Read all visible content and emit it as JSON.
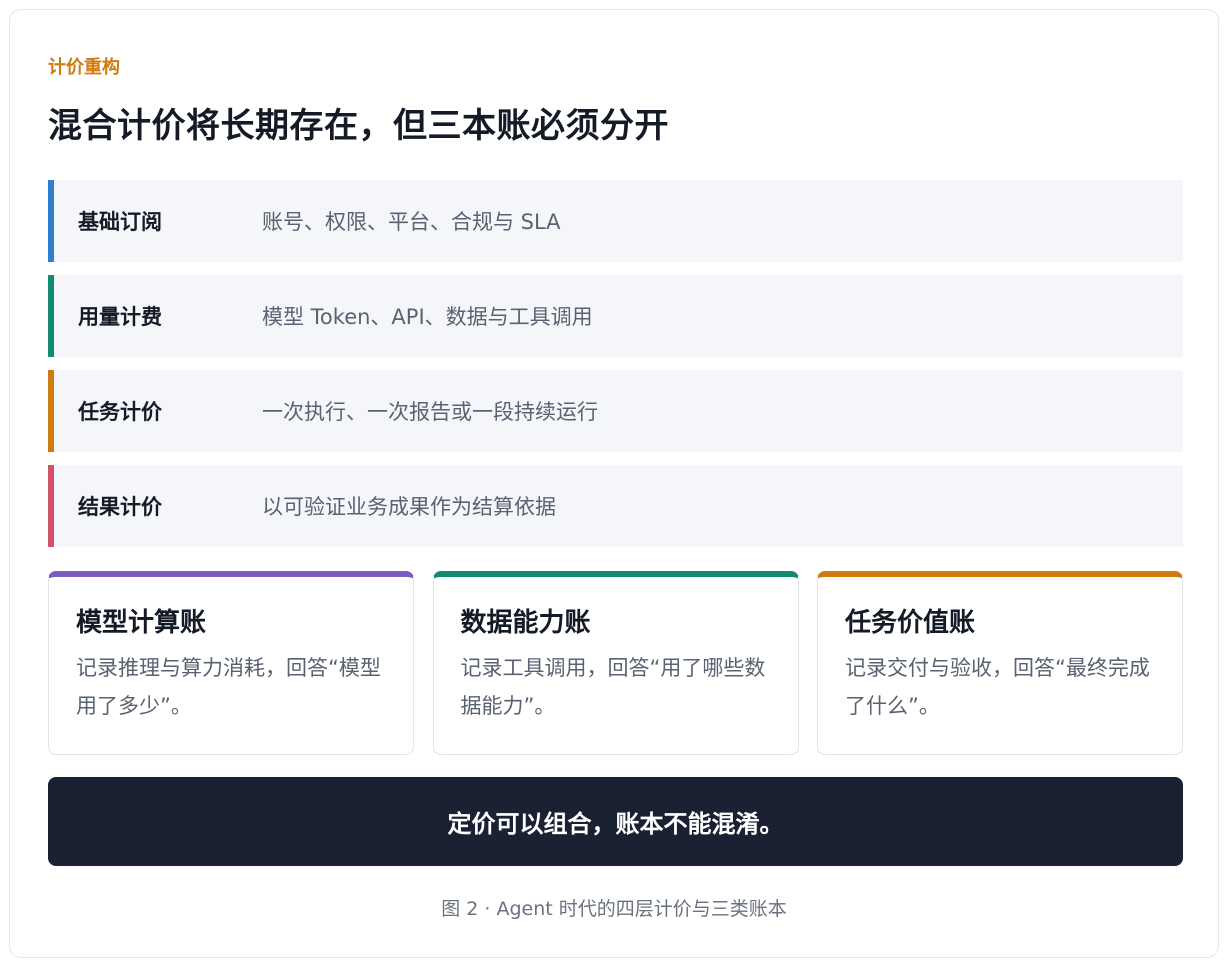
{
  "eyebrow": "计价重构",
  "headline": "混合计价将长期存在，但三本账必须分开",
  "tiers": [
    {
      "name": "基础订阅",
      "desc": "账号、权限、平台、合规与 SLA",
      "color": "#2f7fcf"
    },
    {
      "name": "用量计费",
      "desc": "模型 Token、API、数据与工具调用",
      "color": "#138a72"
    },
    {
      "name": "任务计价",
      "desc": "一次执行、一次报告或一段持续运行",
      "color": "#d07a10"
    },
    {
      "name": "结果计价",
      "desc": "以可验证业务成果作为结算依据",
      "color": "#d4506a"
    }
  ],
  "ledgers": [
    {
      "title": "模型计算账",
      "desc": "记录推理与算力消耗，回答“模型用了多少”。",
      "color": "#7b5cc4"
    },
    {
      "title": "数据能力账",
      "desc": "记录工具调用，回答“用了哪些数据能力”。",
      "color": "#138a72"
    },
    {
      "title": "任务价值账",
      "desc": "记录交付与验收，回答“最终完成了什么”。",
      "color": "#d07a10"
    }
  ],
  "banner": "定价可以组合，账本不能混淆。",
  "caption": "图 2 · Agent 时代的四层计价与三类账本"
}
